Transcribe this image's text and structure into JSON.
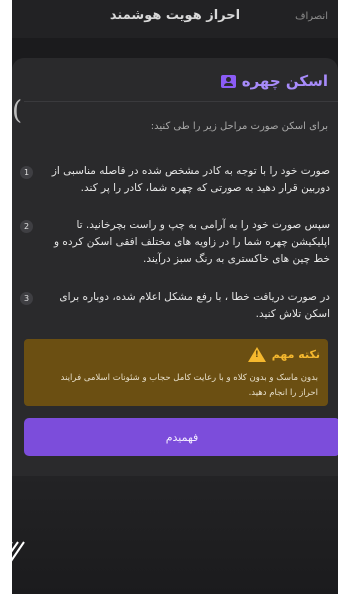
{
  "topbar": {
    "title": "احراز هویت هوشمند",
    "cancel_label": "انصراف"
  },
  "sheet": {
    "left_glyph": "(",
    "header_icon": "id-card-icon",
    "title": "اسکن چهره",
    "intro": "برای اسکن صورت مراحل زیر را طی کنید:",
    "steps": [
      {
        "number": "1",
        "text": "صورت خود را با توجه به کادر مشخص شده در فاصله مناسبی از دوربین قرار دهید به صورتی که چهره شما، کادر را پر کند."
      },
      {
        "number": "2",
        "text": "سپس صورت خود را به آرامی به چپ و راست بچرخانید. تا اپلیکیشن چهره شما را در زاویه های مختلف افقی اسکن کرده و خط چین های خاکستری به رنگ سبز درآیند."
      },
      {
        "number": "3",
        "text": "در صورت دریافت خطا ، با رفع مشکل اعلام شده، دوباره برای اسکن تلاش کنید."
      }
    ],
    "note": {
      "icon": "warning-icon",
      "icon_glyph": "!",
      "title": "نکته مهم",
      "text": "بدون ماسک و بدون کلاه و با رعایت کامل حجاب و شئونات اسلامی فرایند احراز را انجام دهید."
    },
    "cta_label": "فهمیدم"
  },
  "colors": {
    "accent": "#7c4ddb",
    "title": "#a78bfa",
    "warning": "#f5b82e",
    "note_bg": "#6b4f12",
    "sheet_bg": "#2a2a2c",
    "screen_bg": "#1b1b1d"
  }
}
